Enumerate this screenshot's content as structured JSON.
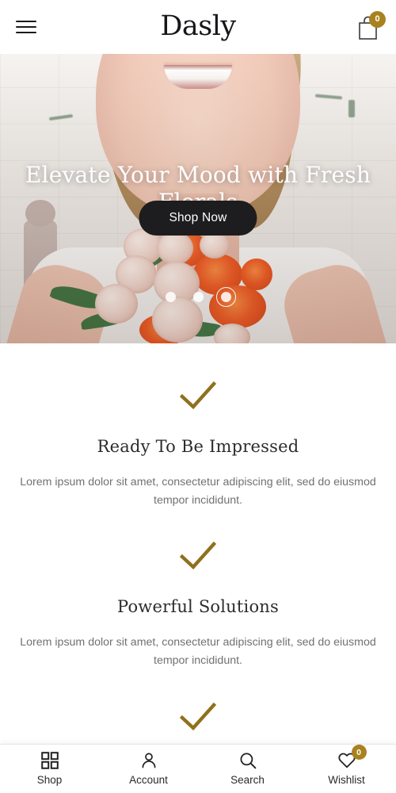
{
  "header": {
    "menu_icon": "hamburger-menu-icon",
    "logo_text": "Dasly",
    "cart_icon": "shopping-bag-icon",
    "cart_count": "0",
    "badge_color": "#a9811f"
  },
  "hero": {
    "title": "Elevate Your Mood with Fresh Florals",
    "cta_label": "Shop Now",
    "slides": [
      {
        "label": "slide-1",
        "active": false
      },
      {
        "label": "slide-2",
        "active": false
      },
      {
        "label": "slide-3",
        "active": true
      }
    ],
    "image_description": "Smiling woman holding a bouquet of cream roses and orange pincushion protea"
  },
  "features": [
    {
      "icon": "check-icon",
      "title": "Ready To Be Impressed",
      "text": "Lorem ipsum dolor sit amet, consectetur adipiscing elit, sed do eiusmod tempor incididunt."
    },
    {
      "icon": "check-icon",
      "title": "Powerful Solutions",
      "text": "Lorem ipsum dolor sit amet, consectetur adipiscing elit, sed do eiusmod tempor incididunt."
    },
    {
      "icon": "check-icon",
      "title": "",
      "text": ""
    }
  ],
  "feature_accent_color": "#8f701d",
  "bottom_nav": [
    {
      "icon": "grid-icon",
      "label": "Shop"
    },
    {
      "icon": "user-icon",
      "label": "Account"
    },
    {
      "icon": "search-icon",
      "label": "Search"
    },
    {
      "icon": "heart-icon",
      "label": "Wishlist",
      "badge": "0"
    }
  ]
}
